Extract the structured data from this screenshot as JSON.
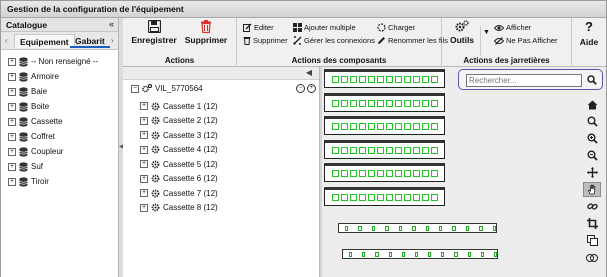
{
  "window": {
    "title": "Gestion de la configuration de l'équipement"
  },
  "catalogue": {
    "header": "Catalogue",
    "tabs": [
      {
        "label": "Equipement"
      },
      {
        "label": "Gabarit"
      }
    ],
    "items": [
      {
        "label": "-- Non renseigné --"
      },
      {
        "label": "Armoire"
      },
      {
        "label": "Baie"
      },
      {
        "label": "Boite"
      },
      {
        "label": "Cassette"
      },
      {
        "label": "Coffret"
      },
      {
        "label": "Coupleur"
      },
      {
        "label": "Suf"
      },
      {
        "label": "Tiroir"
      }
    ]
  },
  "ribbon": {
    "actions": {
      "caption": "Actions",
      "save": "Enregistrer",
      "delete": "Supprimer"
    },
    "components": {
      "caption": "Actions des composants",
      "edit": "Editer",
      "delete": "Supprimer",
      "add_multiple": "Ajouter multiple",
      "manage_links": "Gérer les connexions",
      "load": "Charger",
      "rename_wires": "Renommer les fils"
    },
    "jumpers": {
      "caption": "Actions des jarretières",
      "tools": "Outils",
      "show": "Afficher",
      "hide": "Ne Pas Afficher"
    },
    "help": "Aide"
  },
  "tree": {
    "root": "VIL_5770564",
    "items": [
      {
        "label": "Cassette 1 (12)"
      },
      {
        "label": "Cassette 2 (12)"
      },
      {
        "label": "Cassette 3 (12)"
      },
      {
        "label": "Cassette 4 (12)"
      },
      {
        "label": "Cassette 5 (12)"
      },
      {
        "label": "Cassette 6 (12)"
      },
      {
        "label": "Cassette 7 (12)"
      },
      {
        "label": "Cassette 8 (12)"
      }
    ]
  },
  "visual": {
    "search_placeholder": "Rechercher...",
    "cassette_count": 6,
    "ports_per_cassette": 12,
    "colors": {
      "port": "#22c322",
      "search_border": "#6a4da8",
      "delete_icon": "#d9302c"
    },
    "tools": [
      "home-icon",
      "zoom-icon",
      "zoom-in-icon",
      "zoom-out-icon",
      "pan-icon",
      "hand-icon",
      "link-icon",
      "crop-icon",
      "copy-icon",
      "toggle-icon"
    ]
  }
}
